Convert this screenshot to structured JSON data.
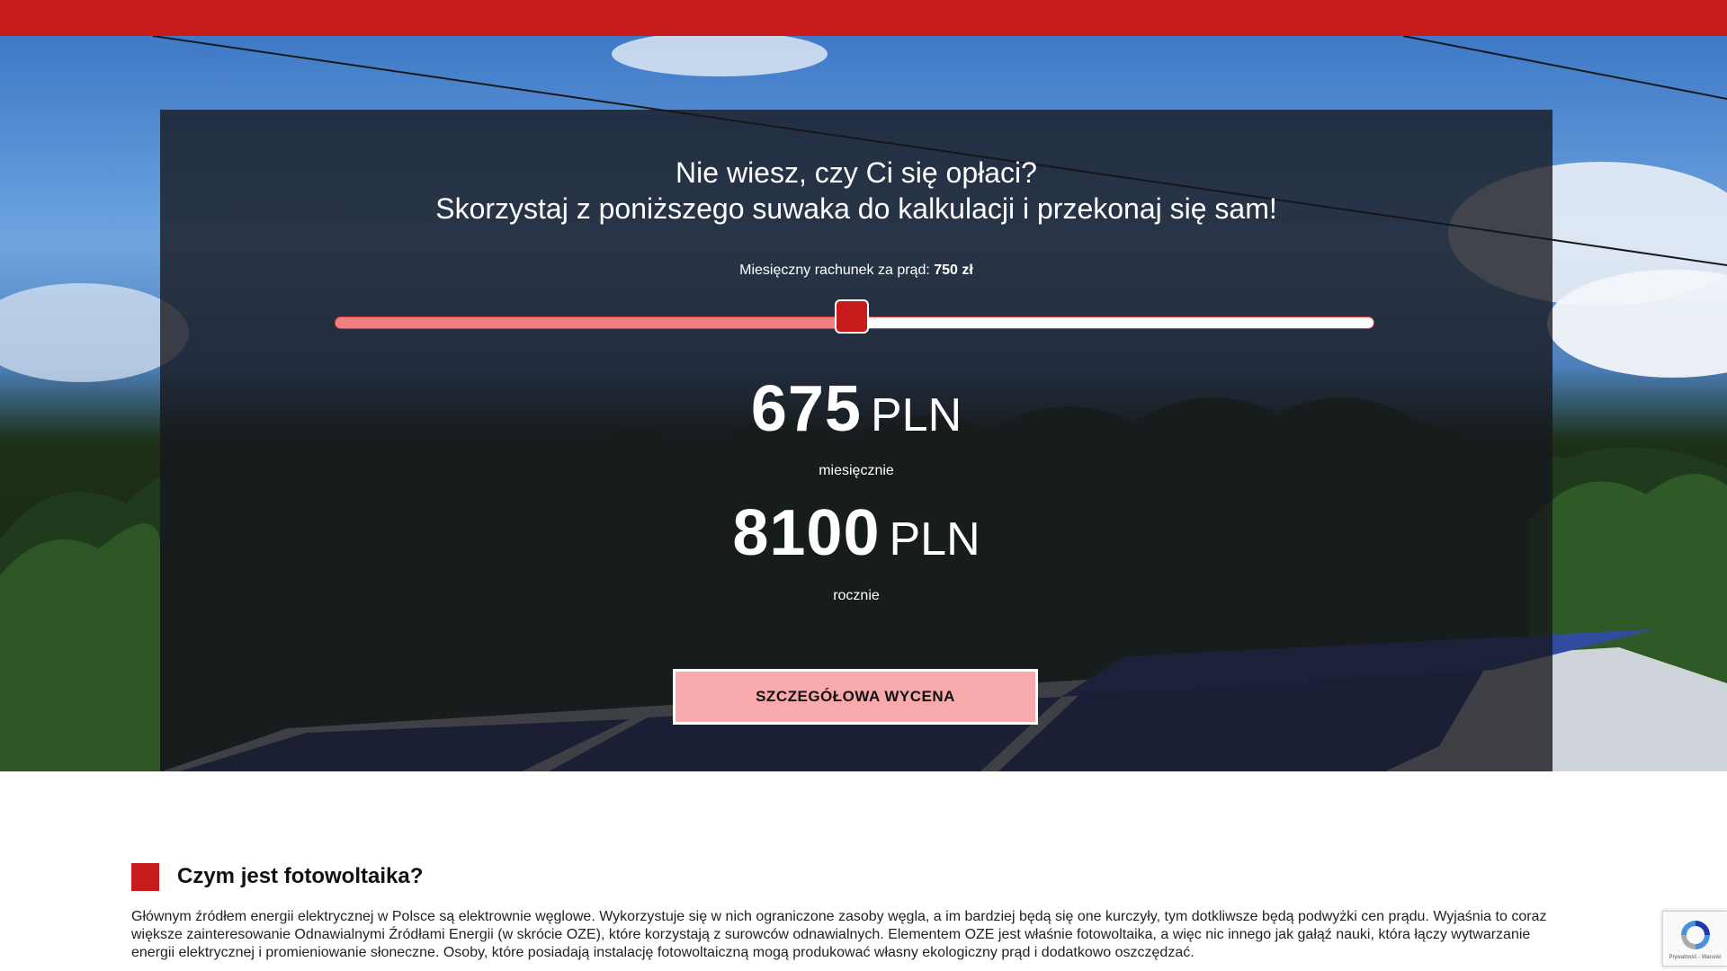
{
  "colors": {
    "accent": "#c81c1c",
    "slider_fill": "#f07f82",
    "cta_bg": "#f8a9ac",
    "panel_bg": "rgba(22,22,28,0.78)"
  },
  "hero": {
    "title_line1": "Nie wiesz, czy Ci się opłaci?",
    "title_line2": "Skorzystaj z poniższego suwaka do kalkulacji i przekonaj się sam!",
    "slider_label": "Miesięczny rachunek za prąd:",
    "slider_value_text": "750 zł",
    "slider_level": 0.497,
    "monthly_amount": "675",
    "monthly_currency": "PLN",
    "monthly_label": "miesięcznie",
    "yearly_amount": "8100",
    "yearly_currency": "PLN",
    "yearly_label": "rocznie",
    "cta_label": "SZCZEGÓŁOWA WYCENA"
  },
  "section": {
    "title": "Czym jest fotowoltaika?",
    "text": "Głównym źródłem energii elektrycznej w Polsce są elektrownie węglowe. Wykorzystuje się w nich ograniczone zasoby węgla, a im bardziej będą się one kurczyły, tym dotkliwsze będą podwyżki cen prądu. Wyjaśnia to coraz większe zainteresowanie Odnawialnymi Źródłami Energii (w skrócie OZE), które korzystają z surowców odnawialnych. Elementem OZE jest właśnie fotowoltaika, a więc nic innego jak gałąź nauki, która łączy wytwarzanie energii elektrycznej i promieniowanie słoneczne. Osoby, które posiadają instalację fotowoltaiczną mogą produkować własny ekologiczny prąd i dodatkowo oszczędzać."
  },
  "recaptcha": {
    "text": "Prywatność - Warunki"
  }
}
